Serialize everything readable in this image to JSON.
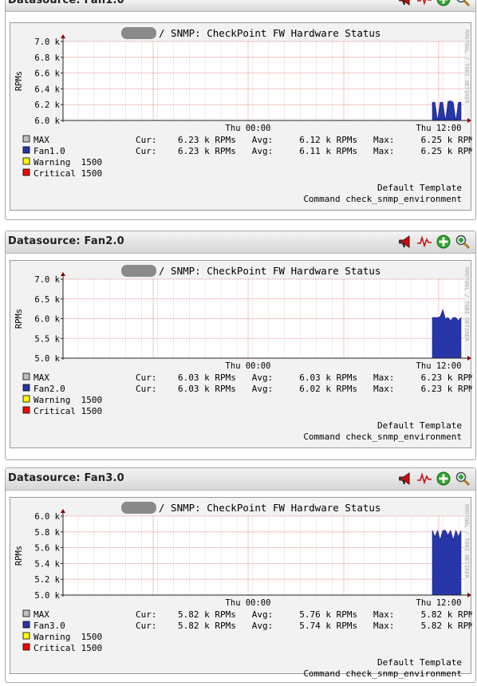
{
  "colors": {
    "max": "#c0c0c0",
    "fan": "#2737a8",
    "warning": "#ffff00",
    "critical": "#ff0000",
    "grid": "#e08080",
    "axis": "#8b0000"
  },
  "icons": [
    "horn-icon",
    "trend-icon",
    "add-icon",
    "zoom-icon"
  ],
  "datasources": [
    {
      "title": "Datasource: Fan1.0",
      "graph_title": "/ SNMP: CheckPoint FW Hardware Status",
      "side_label": "RRDTOOL / TOBI OETIKER",
      "ylabel": "RPMs",
      "yticks": [
        "7.0 k",
        "6.8 k",
        "6.6 k",
        "6.4 k",
        "6.2 k",
        "6.0 k"
      ],
      "xticks": [
        "Thu 00:00",
        "Thu 12:00"
      ],
      "legend": [
        {
          "name": "MAX",
          "stats": "Cur:    6.23 k RPMs   Avg:     6.12 k RPMs   Max:     6.25 k RPM"
        },
        {
          "name": "Fan1.0",
          "stats": "Cur:    6.23 k RPMs   Avg:     6.11 k RPMs   Max:     6.25 k RPM"
        },
        {
          "name": "Warning  1500",
          "stats": ""
        },
        {
          "name": "Critical 1500",
          "stats": ""
        }
      ],
      "template": "Default Template",
      "command": "Command check_snmp_environment",
      "chart_data": {
        "type": "area",
        "ylim": [
          6000,
          7000
        ],
        "xticks": [
          "Thu 00:00",
          "Thu 12:00"
        ],
        "series": [
          {
            "name": "Fan1.0",
            "values_recent": [
              6230,
              6230,
              6000,
              6230,
              6230,
              6000,
              6240,
              6250,
              6230,
              6000,
              6230,
              6230
            ]
          }
        ]
      }
    },
    {
      "title": "Datasource: Fan2.0",
      "graph_title": "/ SNMP: CheckPoint FW Hardware Status",
      "side_label": "RRDTOOL / TOBI OETIKER",
      "ylabel": "RPMs",
      "yticks": [
        "7.0 k",
        "6.5 k",
        "6.0 k",
        "5.5 k",
        "5.0 k"
      ],
      "xticks": [
        "Thu 00:00",
        "Thu 12:00"
      ],
      "legend": [
        {
          "name": "MAX",
          "stats": "Cur:    6.03 k RPMs   Avg:     6.03 k RPMs   Max:     6.23 k RPM"
        },
        {
          "name": "Fan2.0",
          "stats": "Cur:    6.03 k RPMs   Avg:     6.02 k RPMs   Max:     6.23 k RPM"
        },
        {
          "name": "Warning  1500",
          "stats": ""
        },
        {
          "name": "Critical 1500",
          "stats": ""
        }
      ],
      "template": "Default Template",
      "command": "Command check_snmp_environment",
      "chart_data": {
        "type": "area",
        "ylim": [
          5000,
          7000
        ],
        "xticks": [
          "Thu 00:00",
          "Thu 12:00"
        ],
        "series": [
          {
            "name": "Fan2.0",
            "values_recent": [
              6030,
              6030,
              6030,
              6050,
              6230,
              6000,
              6030,
              5950,
              6030,
              6030,
              5950,
              6030
            ]
          }
        ]
      }
    },
    {
      "title": "Datasource: Fan3.0",
      "graph_title": "/ SNMP: CheckPoint FW Hardware Status",
      "side_label": "RRDTOOL / TOBI OETIKER",
      "ylabel": "RPMs",
      "yticks": [
        "6.0 k",
        "5.8 k",
        "5.6 k",
        "5.4 k",
        "5.2 k",
        "5.0 k"
      ],
      "xticks": [
        "Thu 00:00",
        "Thu 12:00"
      ],
      "legend": [
        {
          "name": "MAX",
          "stats": "Cur:    5.82 k RPMs   Avg:     5.76 k RPMs   Max:     5.82 k RPM"
        },
        {
          "name": "Fan3.0",
          "stats": "Cur:    5.82 k RPMs   Avg:     5.74 k RPMs   Max:     5.82 k RPM"
        },
        {
          "name": "Warning  1500",
          "stats": ""
        },
        {
          "name": "Critical 1500",
          "stats": ""
        }
      ],
      "template": "Default Template",
      "command": "Command check_snmp_environment",
      "chart_data": {
        "type": "area",
        "ylim": [
          5000,
          6000
        ],
        "xticks": [
          "Thu 00:00",
          "Thu 12:00"
        ],
        "series": [
          {
            "name": "Fan3.0",
            "values_recent": [
              5820,
              5740,
              5820,
              5700,
              5820,
              5820,
              5760,
              5820,
              5700,
              5820,
              5740,
              5820
            ]
          }
        ]
      }
    }
  ]
}
